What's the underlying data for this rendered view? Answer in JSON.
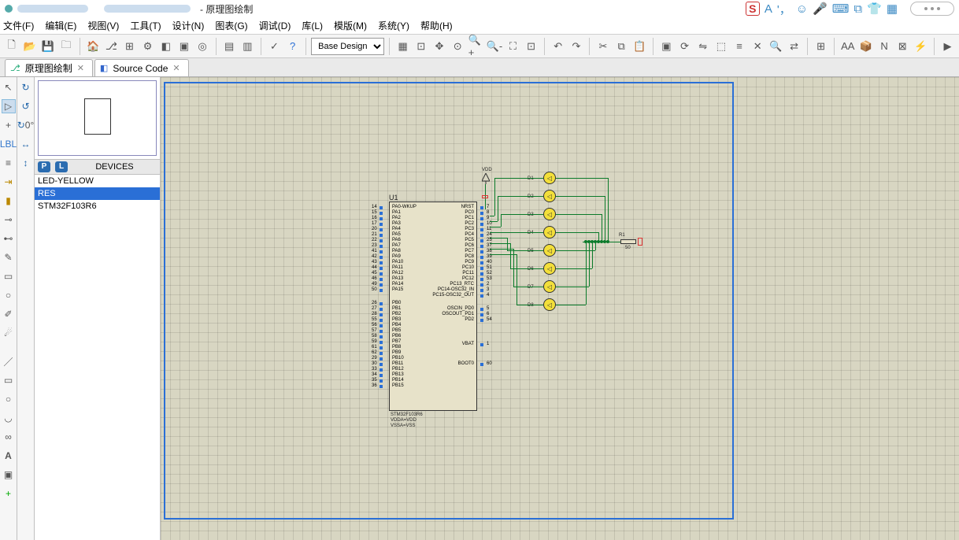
{
  "title_tail": "- 原理图绘制",
  "menus": [
    "文件(F)",
    "编辑(E)",
    "视图(V)",
    "工具(T)",
    "设计(N)",
    "图表(G)",
    "调试(D)",
    "库(L)",
    "模版(M)",
    "系统(Y)",
    "帮助(H)"
  ],
  "design_combo": "Base Design",
  "tabs": [
    {
      "label": "原理图绘制",
      "icon": "⎇"
    },
    {
      "label": "Source Code",
      "icon": "◧"
    }
  ],
  "nav": {
    "angle": "0°"
  },
  "devices_header": "DEVICES",
  "devices": [
    "LED-YELLOW",
    "RES",
    "STM32F103R6"
  ],
  "selected_device_index": 1,
  "chip": {
    "ref": "U1",
    "footer1": "STM32F103R6",
    "footer2": "VDDA=VDD",
    "footer3": "VSSA=VSS",
    "left_pins": [
      {
        "num": "14",
        "name": "PA0-WKUP"
      },
      {
        "num": "15",
        "name": "PA1"
      },
      {
        "num": "16",
        "name": "PA2"
      },
      {
        "num": "17",
        "name": "PA3"
      },
      {
        "num": "20",
        "name": "PA4"
      },
      {
        "num": "21",
        "name": "PA5"
      },
      {
        "num": "22",
        "name": "PA6"
      },
      {
        "num": "23",
        "name": "PA7"
      },
      {
        "num": "41",
        "name": "PA8"
      },
      {
        "num": "42",
        "name": "PA9"
      },
      {
        "num": "43",
        "name": "PA10"
      },
      {
        "num": "44",
        "name": "PA11"
      },
      {
        "num": "45",
        "name": "PA12"
      },
      {
        "num": "46",
        "name": "PA13"
      },
      {
        "num": "49",
        "name": "PA14"
      },
      {
        "num": "50",
        "name": "PA15"
      },
      {
        "num": "26",
        "name": "PB0"
      },
      {
        "num": "27",
        "name": "PB1"
      },
      {
        "num": "28",
        "name": "PB2"
      },
      {
        "num": "55",
        "name": "PB3"
      },
      {
        "num": "56",
        "name": "PB4"
      },
      {
        "num": "57",
        "name": "PB5"
      },
      {
        "num": "58",
        "name": "PB6"
      },
      {
        "num": "59",
        "name": "PB7"
      },
      {
        "num": "61",
        "name": "PB8"
      },
      {
        "num": "62",
        "name": "PB9"
      },
      {
        "num": "29",
        "name": "PB10"
      },
      {
        "num": "30",
        "name": "PB11"
      },
      {
        "num": "33",
        "name": "PB12"
      },
      {
        "num": "34",
        "name": "PB13"
      },
      {
        "num": "35",
        "name": "PB14"
      },
      {
        "num": "36",
        "name": "PB15"
      }
    ],
    "right_pins": [
      {
        "num": "7",
        "name": "NRST"
      },
      {
        "num": "8",
        "name": "PC0"
      },
      {
        "num": "9",
        "name": "PC1"
      },
      {
        "num": "10",
        "name": "PC2"
      },
      {
        "num": "11",
        "name": "PC3"
      },
      {
        "num": "24",
        "name": "PC4"
      },
      {
        "num": "25",
        "name": "PC5"
      },
      {
        "num": "37",
        "name": "PC6"
      },
      {
        "num": "38",
        "name": "PC7"
      },
      {
        "num": "39",
        "name": "PC8"
      },
      {
        "num": "40",
        "name": "PC9"
      },
      {
        "num": "51",
        "name": "PC10"
      },
      {
        "num": "52",
        "name": "PC11"
      },
      {
        "num": "53",
        "name": "PC12"
      },
      {
        "num": "2",
        "name": "PC13_RTC"
      },
      {
        "num": "3",
        "name": "PC14-OSC32_IN"
      },
      {
        "num": "4",
        "name": "PC15-OSC32_OUT"
      },
      {
        "num": "5",
        "name": "OSCIN_PD0"
      },
      {
        "num": "6",
        "name": "OSCOUT_PD1"
      },
      {
        "num": "54",
        "name": "PD2"
      },
      {
        "num": "1",
        "name": "VBAT"
      },
      {
        "num": "60",
        "name": "BOOT0"
      }
    ]
  },
  "leds": [
    "D1",
    "D2",
    "D3",
    "D4",
    "D5",
    "D6",
    "D7",
    "D8"
  ],
  "resistor": {
    "ref": "R1",
    "val": "50"
  },
  "vdd_label": "VDD",
  "ime_letter": "A"
}
